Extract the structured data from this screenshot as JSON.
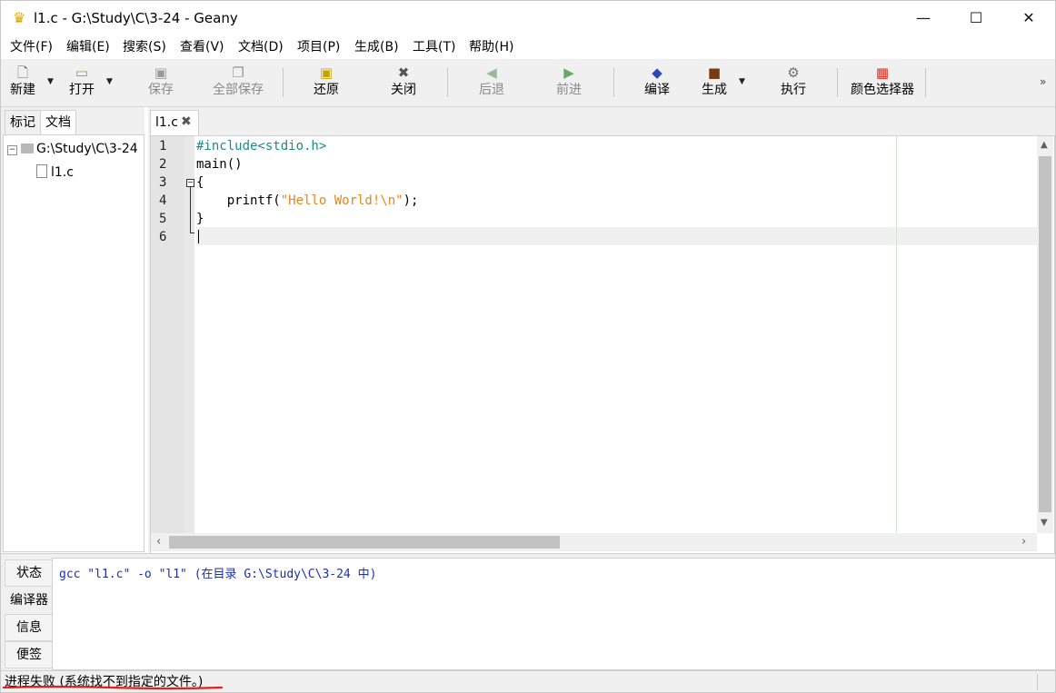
{
  "window": {
    "title": "l1.c - G:\\Study\\C\\3-24 - Geany",
    "controls": {
      "minimize": "—",
      "maximize": "☐",
      "close": "✕"
    }
  },
  "menu": [
    "文件(F)",
    "编辑(E)",
    "搜索(S)",
    "查看(V)",
    "文档(D)",
    "项目(P)",
    "生成(B)",
    "工具(T)",
    "帮助(H)"
  ],
  "toolbar": {
    "new": "新建",
    "open": "打开",
    "save": "保存",
    "save_all": "全部保存",
    "revert": "还原",
    "close": "关闭",
    "back": "后退",
    "forward": "前进",
    "compile": "编译",
    "build": "生成",
    "execute": "执行",
    "color_chooser": "颜色选择器"
  },
  "sidebar": {
    "tabs": [
      "标记",
      "文档"
    ],
    "active_tab": "文档",
    "tree": {
      "folder": "G:\\Study\\C\\3-24",
      "files": [
        "l1.c"
      ]
    }
  },
  "editor": {
    "tab_name": "l1.c",
    "line_numbers": [
      "1",
      "2",
      "3",
      "4",
      "5",
      "6"
    ],
    "lines": {
      "l1": "#include<stdio.h>",
      "l2": "main()",
      "l3": "{",
      "l4_indent": "    printf(",
      "l4_string": "\"Hello World!\\n\"",
      "l4_tail": ");",
      "l5": "}",
      "l6": ""
    },
    "current_line": 6
  },
  "messages": {
    "tabs": [
      "状态",
      "编译器",
      "信息",
      "便签"
    ],
    "active_tab": "编译器",
    "text": "gcc \"l1.c\" -o \"l1\" (在目录 G:\\Study\\C\\3-24 中)"
  },
  "statusbar": {
    "text": "进程失败 (系统找不到指定的文件。)"
  },
  "colors": {
    "preprocessor": "#1c8a8a",
    "string": "#e8861c",
    "message": "#1a2fb0",
    "annotation": "#e0201c"
  }
}
